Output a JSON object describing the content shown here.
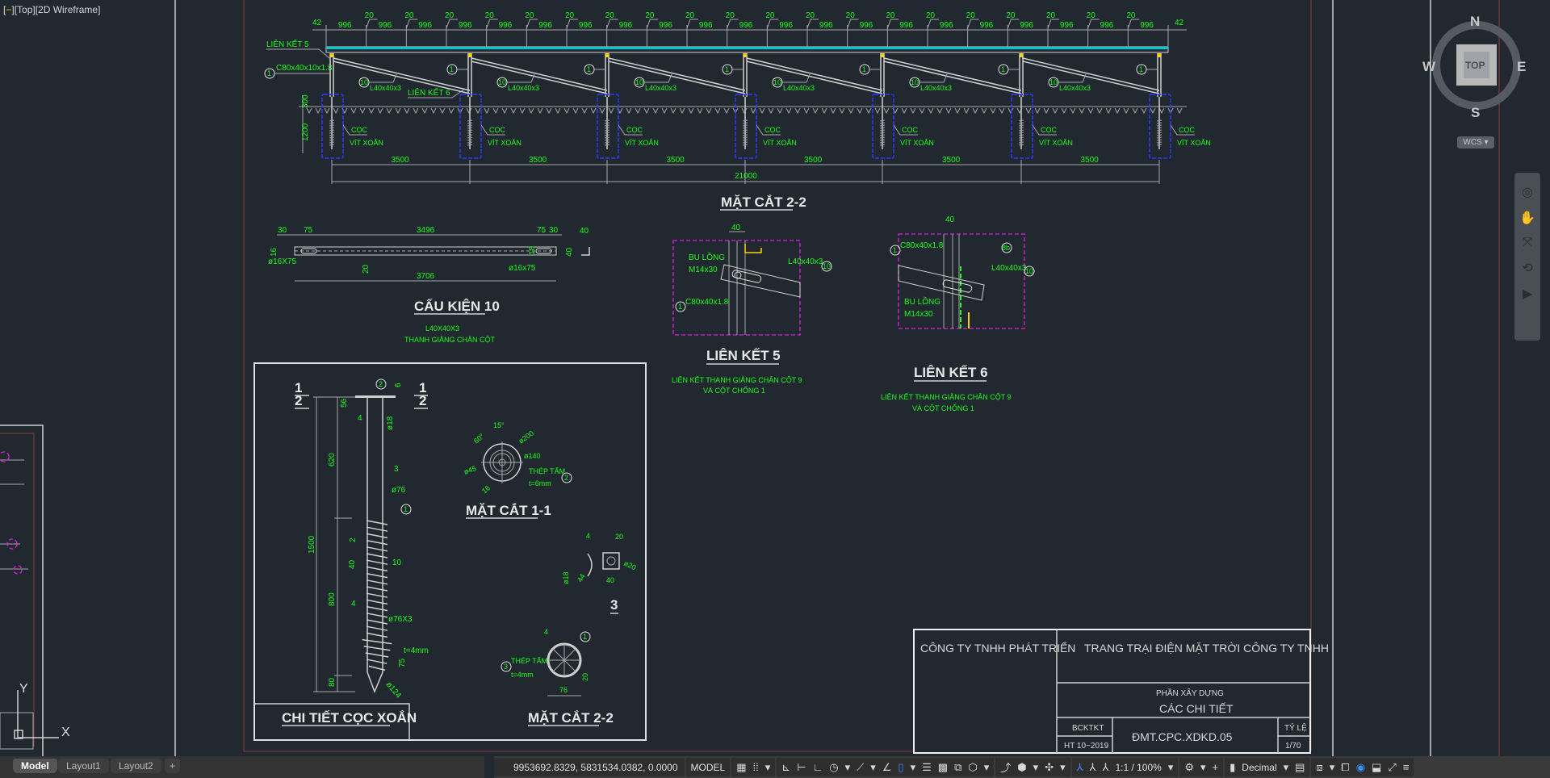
{
  "viewport": {
    "label_minus": "−",
    "label_view": "[Top][2D Wireframe]"
  },
  "section22": {
    "title": "MẶT CẮT 2-2",
    "end_dim": "42",
    "panel_dim": "996",
    "gap_dim": "20",
    "panel_count": 21,
    "post_spacing": "3500",
    "total_length": "21000",
    "height_above": "300",
    "height_below": "1200",
    "lien_ket_5": "LIÊN KẾT 5",
    "lien_ket_6": "LIÊN KẾT 6",
    "column_spec": "C80x40x10x1.8",
    "column_mark": "1",
    "brace_mark": "10",
    "brace_spec": "L40x40x3",
    "pile_line1": "CỌC",
    "pile_line2": "VÍT XOẮN"
  },
  "cau_kien_10": {
    "title": "CẤU KIỆN 10",
    "sub1": "L40X40X3",
    "sub2": "THANH GIẰNG CHÂN CỘT",
    "dims": {
      "d30a": "30",
      "d75a": "75",
      "d3496": "3496",
      "d75b": "75",
      "d30b": "30",
      "d40a": "40",
      "d16": "16",
      "slot_left": "ø16X75",
      "d20": "20",
      "d18": "18",
      "slot_right": "ø16x75",
      "d3706": "3706",
      "d40b": "40"
    }
  },
  "lien_ket_5": {
    "title": "LIÊN KẾT 5",
    "dim": "40",
    "bolt1": "BU LỒNG",
    "bolt2": "M14x30",
    "brace": "L40x40x3",
    "brace_mark": "10",
    "col_mark": "1",
    "col": "C80x40x1.8",
    "sub1": "LIÊN KẾT THANH GIẰNG CHÂN CỘT 9",
    "sub2": "VÀ CỘT CHỐNG 1"
  },
  "lien_ket_6": {
    "title": "LIÊN KẾT 6",
    "dim": "40",
    "bolt1": "BU LỒNG",
    "bolt2": "M14x30",
    "brace": "L40x40x3",
    "brace_mark": "10",
    "col_mark": "1",
    "col": "C80x40x1.8",
    "plate_mark": "8b",
    "sub1": "LIÊN KẾT THANH GIẰNG CHÂN CỘT 9",
    "sub2": "VÀ CỘT CHỐNG 1"
  },
  "coc_xoan": {
    "title": "CHI TIẾT CỌC XOẮN",
    "sec_top": "1",
    "sec_bot": "2",
    "dims": {
      "d1500": "1500",
      "d620": "620",
      "d800": "800",
      "d80": "80",
      "d56": "56",
      "d6": "6",
      "d18": "ø18",
      "d3": "3",
      "d76": "ø76",
      "d2": "2",
      "d40": "40",
      "d10": "10",
      "d76x3": "ø76X3",
      "t4": "t=4mm",
      "d75": "75",
      "d124": "ø124",
      "w4a": "4",
      "w4b": "4"
    },
    "mark1": "1",
    "mark2": "2"
  },
  "mat_cat_11": {
    "title": "MẶT CẮT 1-1",
    "a60": "60°",
    "a15": "15°",
    "d200": "ø200",
    "d140": "ø140",
    "d45": "ø45",
    "plate": "THÉP TẤM",
    "t": "t=6mm",
    "mark": "2",
    "d16": "16"
  },
  "detail_3": {
    "title": "3",
    "d4": "4",
    "d20": "20",
    "d18": "ø18",
    "d44": "44",
    "d20b": "ø20",
    "d40": "40"
  },
  "mat_cat_22_small": {
    "title": "MẶT CẮT 2-2",
    "d4": "4",
    "mark1": "1",
    "plate": "THÉP TẤM",
    "mark3": "3",
    "t": "t=4mm",
    "d20": "20",
    "d76": "76"
  },
  "title_block": {
    "company": "CÔNG TY TNHH PHÁT TRIỂN",
    "project": "TRANG TRẠI ĐIỆN MẶT TRỜI CÔNG TY TNHH",
    "part": "PHẦN XÂY DỰNG",
    "drawing": "CÁC CHI TIẾT",
    "stage": "BCKTKT",
    "date": "HT 10−2019",
    "code": "ĐMT.CPC.XDKD.05",
    "scale_label": "TỶ LỆ",
    "scale": "1/70"
  },
  "viewcube": {
    "n": "N",
    "s": "S",
    "e": "E",
    "w": "W",
    "top": "TOP",
    "wcs": "WCS ▾"
  },
  "ucs": {
    "x": "X",
    "y": "Y"
  },
  "tabs": [
    {
      "label": "Model",
      "active": true
    },
    {
      "label": "Layout1"
    },
    {
      "label": "Layout2"
    },
    {
      "label": "+"
    }
  ],
  "statusbar": {
    "coords": "9953692.8329, 5831534.0382, 0.0000",
    "space": "MODEL",
    "annoscale": "1:1 / 100%",
    "units": "Decimal"
  },
  "colors": {
    "background": "#212830",
    "dimension_text": "#1cff1c",
    "detail_box": "#e020e0",
    "pile_box": "#2a3cff",
    "panel": "#00c8d0"
  }
}
